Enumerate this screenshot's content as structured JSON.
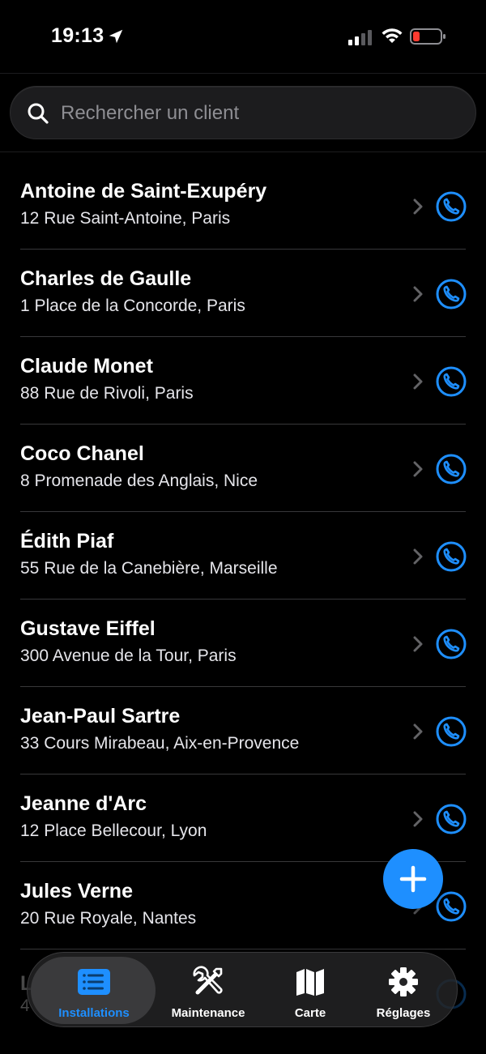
{
  "status_bar": {
    "time": "19:13"
  },
  "search": {
    "placeholder": "Rechercher un client"
  },
  "clients": [
    {
      "name": "Antoine de Saint-Exupéry",
      "address": "12 Rue Saint-Antoine, Paris"
    },
    {
      "name": "Charles de Gaulle",
      "address": "1 Place de la Concorde, Paris"
    },
    {
      "name": "Claude Monet",
      "address": "88 Rue de Rivoli, Paris"
    },
    {
      "name": "Coco Chanel",
      "address": "8 Promenade des Anglais, Nice"
    },
    {
      "name": "Édith Piaf",
      "address": "55 Rue de la Canebière, Marseille"
    },
    {
      "name": "Gustave Eiffel",
      "address": "300 Avenue de la Tour, Paris"
    },
    {
      "name": "Jean-Paul Sartre",
      "address": "33 Cours Mirabeau, Aix-en-Provence"
    },
    {
      "name": "Jeanne d'Arc",
      "address": "12 Place Bellecour, Lyon"
    },
    {
      "name": "Jules Verne",
      "address": "20 Rue Royale, Nantes"
    }
  ],
  "partial_row": {
    "name_initial": "L",
    "address_initial": "4"
  },
  "tabs": [
    {
      "label": "Installations",
      "icon": "list-icon",
      "active": true
    },
    {
      "label": "Maintenance",
      "icon": "tools-icon",
      "active": false
    },
    {
      "label": "Carte",
      "icon": "map-icon",
      "active": false
    },
    {
      "label": "Réglages",
      "icon": "gear-icon",
      "active": false
    }
  ],
  "colors": {
    "accent": "#1e8fff",
    "background": "#000000",
    "battery_low": "#ff3b30"
  }
}
